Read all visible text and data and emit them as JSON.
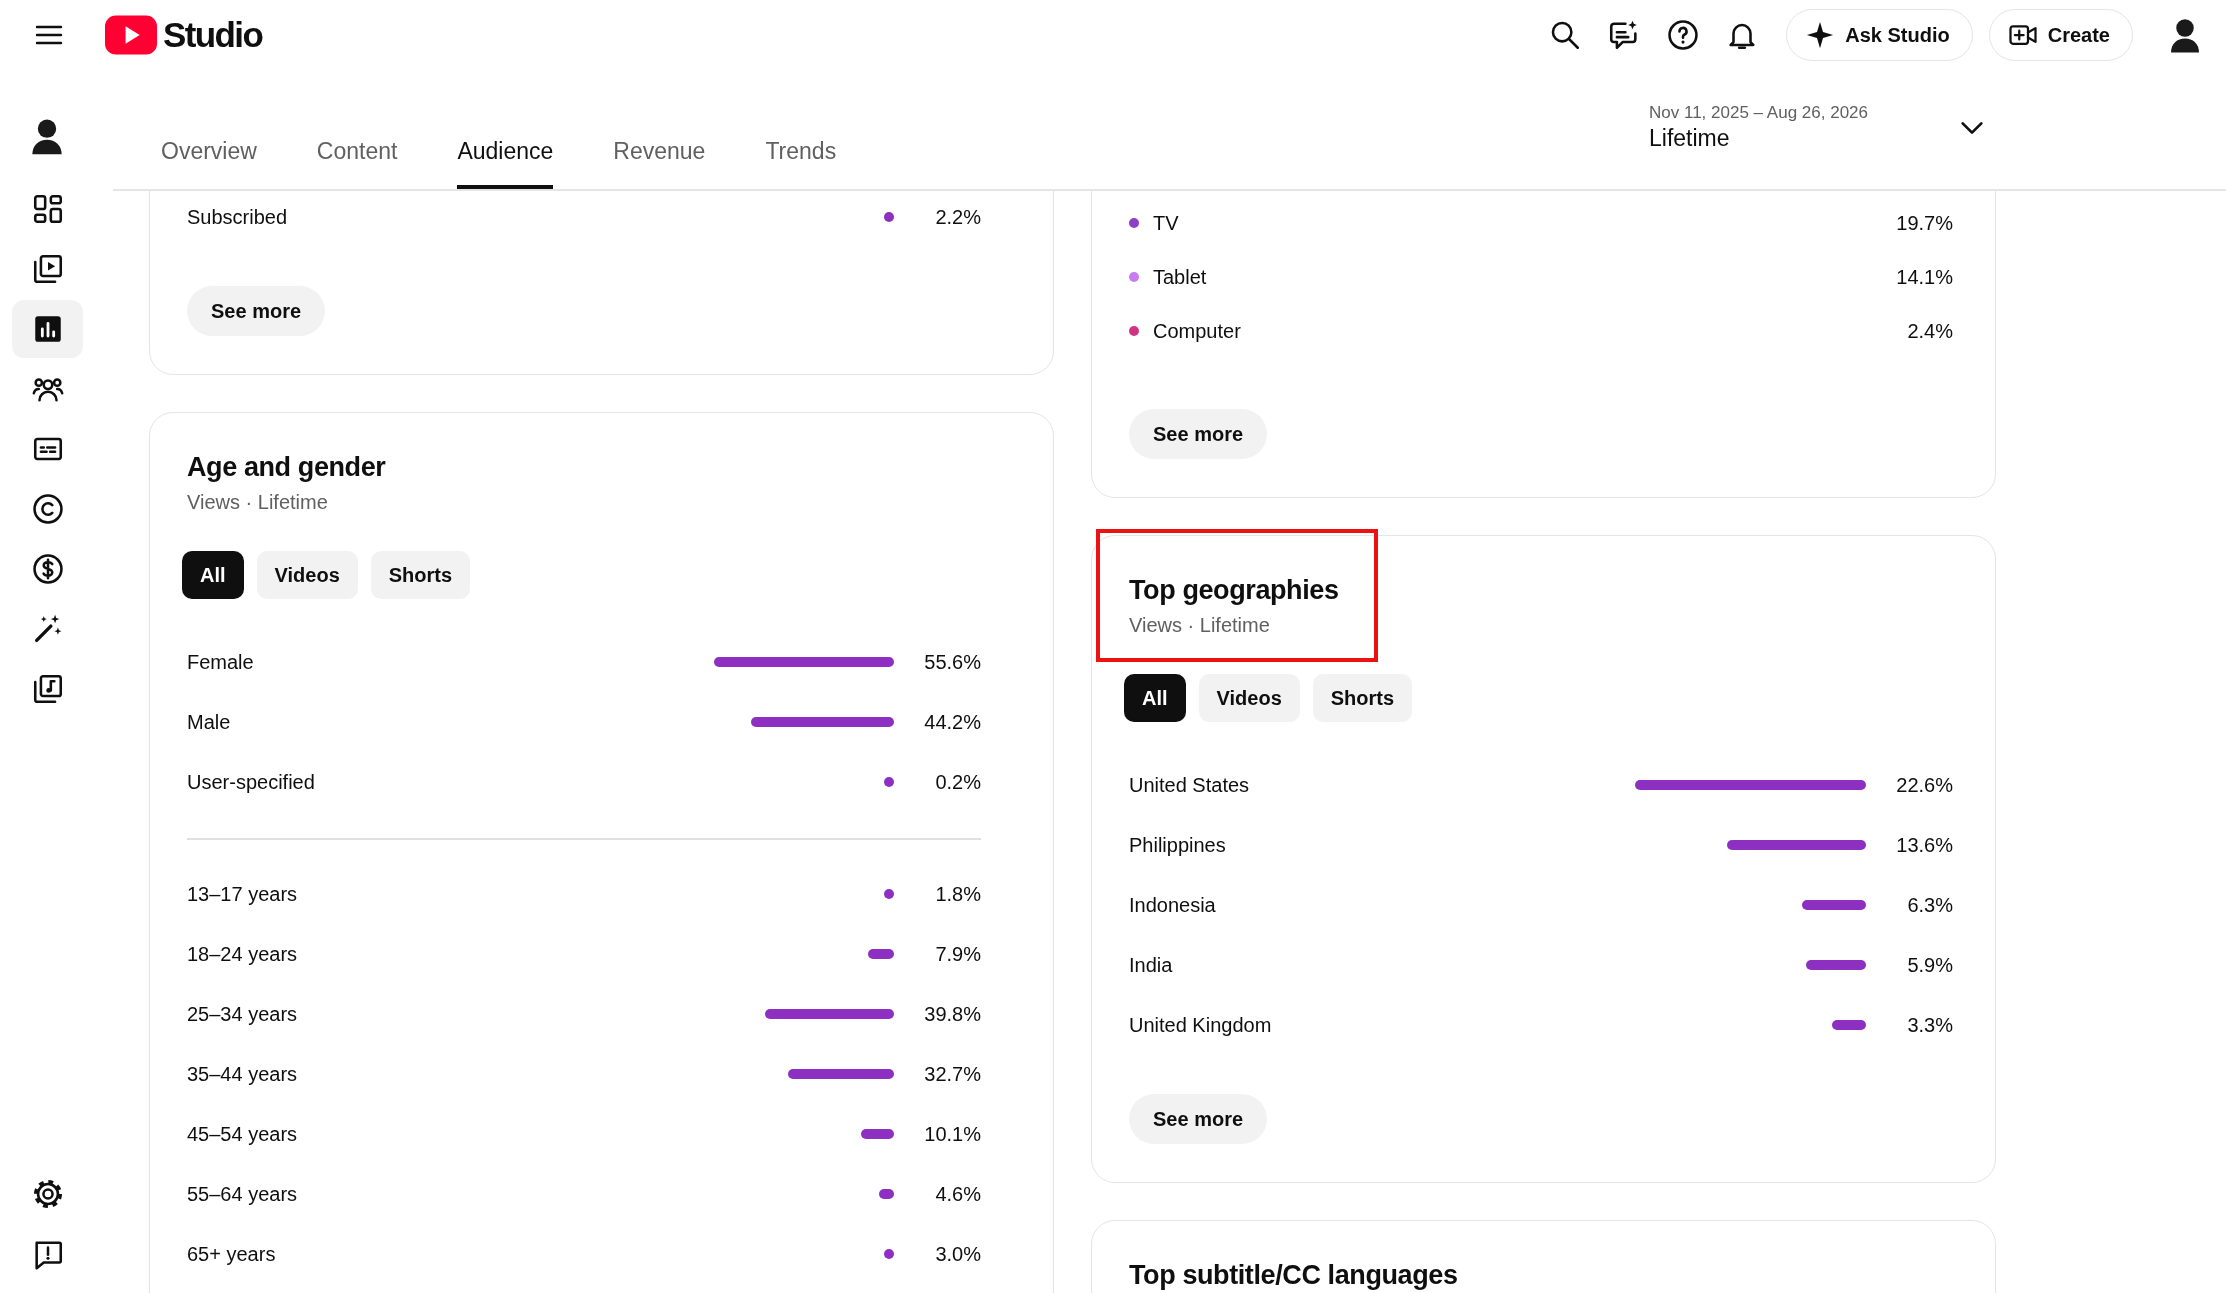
{
  "header": {
    "logo_text": "Studio",
    "ask_button": "Ask Studio",
    "create_button": "Create"
  },
  "sidebar": {
    "items": [
      {
        "selected": false
      },
      {
        "selected": false
      },
      {
        "selected": true
      },
      {
        "selected": false
      },
      {
        "selected": false
      },
      {
        "selected": false
      },
      {
        "selected": false
      },
      {
        "selected": false
      },
      {
        "selected": false
      }
    ],
    "bottom_items": [
      {
        "selected": false
      },
      {
        "selected": false
      }
    ]
  },
  "tabs": [
    {
      "label": "Overview",
      "selected": false
    },
    {
      "label": "Content",
      "selected": false
    },
    {
      "label": "Audience",
      "selected": true
    },
    {
      "label": "Revenue",
      "selected": false
    },
    {
      "label": "Trends",
      "selected": false
    }
  ],
  "date_range": {
    "range": "Nov 11, 2025 – Aug 26, 2026",
    "value": "Lifetime"
  },
  "left_column": [
    {
      "groups": [
        {
          "kind": "bar",
          "rows": [
            {
              "label": "Subscribed",
              "value": "2.2%"
            }
          ]
        }
      ],
      "button": "See more"
    },
    {
      "title": "Age and gender",
      "subtitle": "Views · Lifetime",
      "highlighted": false,
      "filters": [
        {
          "label": "All",
          "selected": true
        },
        {
          "label": "Videos",
          "selected": false
        },
        {
          "label": "Shorts",
          "selected": false
        }
      ],
      "groups": [
        {
          "kind": "bar",
          "rows": [
            {
              "label": "Female",
              "value": "55.6%"
            },
            {
              "label": "Male",
              "value": "44.2%"
            },
            {
              "label": "User-specified",
              "value": "0.2%"
            }
          ]
        },
        {
          "kind": "bar",
          "rows": [
            {
              "label": "13–17 years",
              "value": "1.8%"
            },
            {
              "label": "18–24 years",
              "value": "7.9%"
            },
            {
              "label": "25–34 years",
              "value": "39.8%"
            },
            {
              "label": "35–44 years",
              "value": "32.7%"
            },
            {
              "label": "45–54 years",
              "value": "10.1%"
            },
            {
              "label": "55–64 years",
              "value": "4.6%"
            },
            {
              "label": "65+ years",
              "value": "3.0%"
            }
          ]
        }
      ]
    }
  ],
  "right_column": [
    {
      "groups": [
        {
          "kind": "legend",
          "rows": [
            {
              "label": "TV",
              "value": "19.7%",
              "color": "#8e3fc6"
            },
            {
              "label": "Tablet",
              "value": "14.1%",
              "color": "#c77cf0"
            },
            {
              "label": "Computer",
              "value": "2.4%",
              "color": "#cf3381"
            }
          ]
        }
      ],
      "button": "See more"
    },
    {
      "title": "Top geographies",
      "subtitle": "Views · Lifetime",
      "highlighted": true,
      "filters": [
        {
          "label": "All",
          "selected": true
        },
        {
          "label": "Videos",
          "selected": false
        },
        {
          "label": "Shorts",
          "selected": false
        }
      ],
      "groups": [
        {
          "kind": "bar",
          "rows": [
            {
              "label": "United States",
              "value": "22.6%"
            },
            {
              "label": "Philippines",
              "value": "13.6%"
            },
            {
              "label": "Indonesia",
              "value": "6.3%"
            },
            {
              "label": "India",
              "value": "5.9%"
            },
            {
              "label": "United Kingdom",
              "value": "3.3%"
            }
          ]
        }
      ],
      "button": "See more"
    },
    {
      "title": "Top subtitle/CC languages",
      "highlighted": false
    }
  ]
}
